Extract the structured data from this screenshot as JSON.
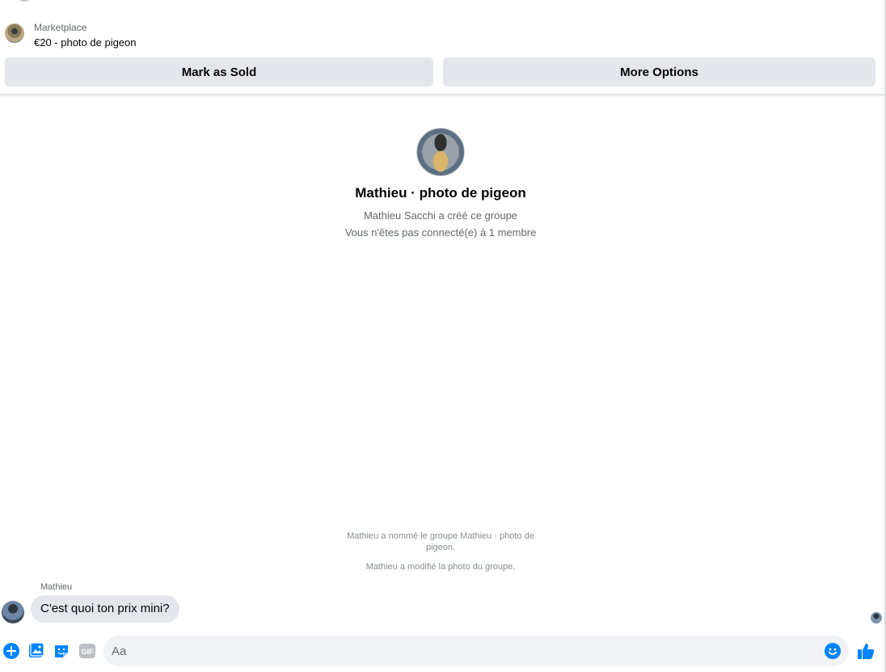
{
  "listing": {
    "category": "Marketplace",
    "title": "€20 - photo de pigeon"
  },
  "actions": {
    "mark_sold": "Mark as Sold",
    "more_options": "More Options"
  },
  "group": {
    "name": "Mathieu · photo de pigeon",
    "created_by": "Mathieu Sacchi a créé ce groupe",
    "connection": "Vous n'êtes pas connecté(e) à 1 membre"
  },
  "system_messages": [
    "Mathieu a nommé le groupe Mathieu · photo de pigeon.",
    "Mathieu a modifié la photo du groupe."
  ],
  "message": {
    "sender": "Mathieu",
    "text": "C'est quoi ton prix mini?"
  },
  "composer": {
    "placeholder": "Aa",
    "gif_label": "GIF"
  },
  "colors": {
    "accent": "#0084ff",
    "button_bg": "#e4e6eb",
    "muted_text": "#65676b"
  }
}
